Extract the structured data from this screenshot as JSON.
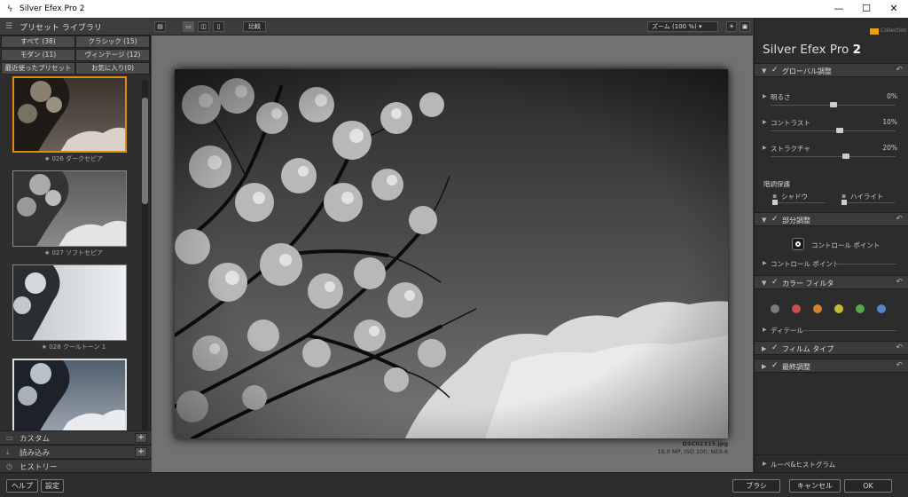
{
  "window": {
    "title": "Silver Efex Pro 2",
    "minimize": "—",
    "maximize": "☐",
    "close": "✕"
  },
  "library": {
    "title": "プリセット ライブラリ",
    "tabs": [
      {
        "label": "すべて (38)"
      },
      {
        "label": "クラシック (15)"
      },
      {
        "label": "モダン (11)"
      },
      {
        "label": "ヴィンテージ (12)"
      },
      {
        "label": "最近使ったプリセット"
      },
      {
        "label": "お気に入り(0)"
      }
    ],
    "presets": [
      {
        "label": "★ 026 ダークセピア"
      },
      {
        "label": "★ 027 ソフトセピア"
      },
      {
        "label": "★ 028 クールトーン 1"
      }
    ],
    "sections": [
      {
        "label": "カスタム",
        "plus": "+"
      },
      {
        "label": "読み込み",
        "plus": "+"
      },
      {
        "label": "ヒストリー"
      }
    ]
  },
  "toolbar": {
    "compare_label": "比較",
    "zoom_label": "ズーム (100 %)"
  },
  "image": {
    "filename": "DSC02315.jpg",
    "details": "16.0 MP, ISO 100, NEX-6"
  },
  "right_panel": {
    "brand": "Collection",
    "title": "Silver Efex Pro",
    "title_num": "2",
    "global": {
      "label": "グローバル調整",
      "sliders": [
        {
          "label": "明るさ",
          "value": "0%",
          "level": 0.5
        },
        {
          "label": "コントラスト",
          "value": "10%",
          "level": 0.55
        },
        {
          "label": "ストラクチャ",
          "value": "20%",
          "level": 0.6
        }
      ],
      "tone_label": "階調保護",
      "shadow": "シャドウ",
      "highlight": "ハイライト"
    },
    "local": {
      "label": "部分調整",
      "cp_button": "コントロール ポイント",
      "cp_row": "コントロール ポイント"
    },
    "color_filter": {
      "label": "カラー フィルタ",
      "colors": [
        "#7a7a7a",
        "#c75050",
        "#d08030",
        "#c8b838",
        "#55a845",
        "#5585c8"
      ],
      "detail": "ディテール"
    },
    "film": {
      "label": "フィルム タイプ"
    },
    "finish": {
      "label": "最終調整"
    },
    "loupe": {
      "label": "ルーペ&ヒストグラム"
    }
  },
  "bottom": {
    "help": "ヘルプ",
    "settings": "設定",
    "brush": "ブラシ",
    "cancel": "キャンセル",
    "ok": "OK"
  }
}
